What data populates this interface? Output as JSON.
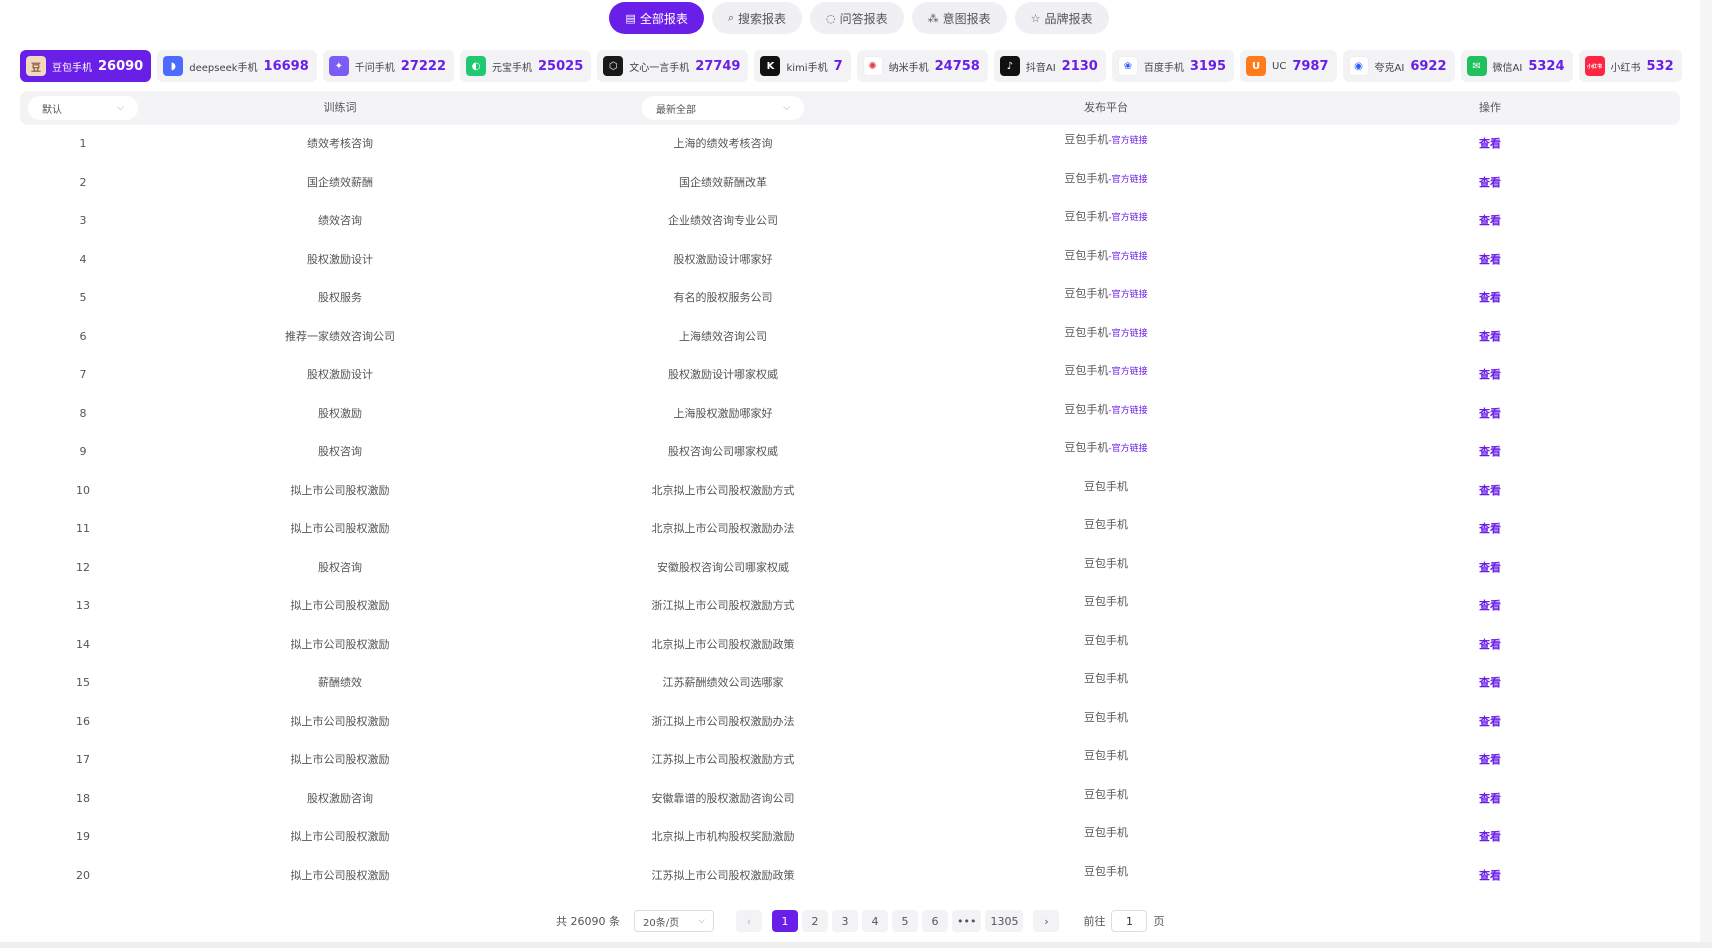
{
  "tabs": [
    {
      "label": "全部报表",
      "icon": "report-icon",
      "active": true
    },
    {
      "label": "搜索报表",
      "icon": "search-icon",
      "active": false
    },
    {
      "label": "问答报表",
      "icon": "chat-icon",
      "active": false
    },
    {
      "label": "意图报表",
      "icon": "intent-icon",
      "active": false
    },
    {
      "label": "品牌报表",
      "icon": "star-icon",
      "active": false
    }
  ],
  "platforms": [
    {
      "name": "豆包手机",
      "count": "26090",
      "icon": "doubao-icon",
      "color": "#f1d9c0",
      "glyph": "豆",
      "active": true
    },
    {
      "name": "deepseek手机",
      "count": "16698",
      "icon": "deepseek-icon",
      "color": "#4d6bfe",
      "glyph": "◗",
      "active": false
    },
    {
      "name": "千问手机",
      "count": "27222",
      "icon": "qianwen-icon",
      "color": "#7b5cf5",
      "glyph": "✦",
      "active": false
    },
    {
      "name": "元宝手机",
      "count": "25025",
      "icon": "yuanbao-icon",
      "color": "#1fc873",
      "glyph": "◐",
      "active": false
    },
    {
      "name": "文心一言手机",
      "count": "27749",
      "icon": "wenxin-icon",
      "color": "#1a1a1a",
      "glyph": "⬡",
      "active": false
    },
    {
      "name": "kimi手机",
      "count": "7",
      "icon": "kimi-icon",
      "color": "#111111",
      "glyph": "K",
      "active": false
    },
    {
      "name": "纳米手机",
      "count": "24758",
      "icon": "nami-icon",
      "color": "#ffffff",
      "glyph": "✺",
      "active": false
    },
    {
      "name": "抖音AI",
      "count": "2130",
      "icon": "douyin-icon",
      "color": "#111111",
      "glyph": "♪",
      "active": false
    },
    {
      "name": "百度手机",
      "count": "3195",
      "icon": "baidu-icon",
      "color": "#ffffff",
      "glyph": "❀",
      "active": false
    },
    {
      "name": "UC",
      "count": "7987",
      "icon": "uc-icon",
      "color": "#ff7a1a",
      "glyph": "U",
      "active": false
    },
    {
      "name": "夸克AI",
      "count": "6922",
      "icon": "quark-icon",
      "color": "#ffffff",
      "glyph": "◉",
      "active": false
    },
    {
      "name": "微信AI",
      "count": "5324",
      "icon": "wechat-icon",
      "color": "#20c05c",
      "glyph": "✉",
      "active": false
    },
    {
      "name": "小红书",
      "count": "532",
      "icon": "xiaohongshu-icon",
      "color": "#ff2442",
      "glyph": "小红书",
      "active": false
    }
  ],
  "table": {
    "sort_select": "默认",
    "col_keyword": "训练词",
    "filter_select": "最新全部",
    "col_platform": "发布平台",
    "col_action": "操作",
    "official_link": "-官方链接",
    "view_label": "查看",
    "rows": [
      {
        "index": "1",
        "keyword": "绩效考核咨询",
        "question": "上海的绩效考核咨询",
        "platform": "豆包手机",
        "official": true
      },
      {
        "index": "2",
        "keyword": "国企绩效薪酬",
        "question": "国企绩效薪酬改革",
        "platform": "豆包手机",
        "official": true
      },
      {
        "index": "3",
        "keyword": "绩效咨询",
        "question": "企业绩效咨询专业公司",
        "platform": "豆包手机",
        "official": true
      },
      {
        "index": "4",
        "keyword": "股权激励设计",
        "question": "股权激励设计哪家好",
        "platform": "豆包手机",
        "official": true
      },
      {
        "index": "5",
        "keyword": "股权服务",
        "question": "有名的股权服务公司",
        "platform": "豆包手机",
        "official": true
      },
      {
        "index": "6",
        "keyword": "推荐一家绩效咨询公司",
        "question": "上海绩效咨询公司",
        "platform": "豆包手机",
        "official": true
      },
      {
        "index": "7",
        "keyword": "股权激励设计",
        "question": "股权激励设计哪家权威",
        "platform": "豆包手机",
        "official": true
      },
      {
        "index": "8",
        "keyword": "股权激励",
        "question": "上海股权激励哪家好",
        "platform": "豆包手机",
        "official": true
      },
      {
        "index": "9",
        "keyword": "股权咨询",
        "question": "股权咨询公司哪家权威",
        "platform": "豆包手机",
        "official": true
      },
      {
        "index": "10",
        "keyword": "拟上市公司股权激励",
        "question": "北京拟上市公司股权激励方式",
        "platform": "豆包手机",
        "official": false
      },
      {
        "index": "11",
        "keyword": "拟上市公司股权激励",
        "question": "北京拟上市公司股权激励办法",
        "platform": "豆包手机",
        "official": false
      },
      {
        "index": "12",
        "keyword": "股权咨询",
        "question": "安徽股权咨询公司哪家权威",
        "platform": "豆包手机",
        "official": false
      },
      {
        "index": "13",
        "keyword": "拟上市公司股权激励",
        "question": "浙江拟上市公司股权激励方式",
        "platform": "豆包手机",
        "official": false
      },
      {
        "index": "14",
        "keyword": "拟上市公司股权激励",
        "question": "北京拟上市公司股权激励政策",
        "platform": "豆包手机",
        "official": false
      },
      {
        "index": "15",
        "keyword": "薪酬绩效",
        "question": "江苏薪酬绩效公司选哪家",
        "platform": "豆包手机",
        "official": false
      },
      {
        "index": "16",
        "keyword": "拟上市公司股权激励",
        "question": "浙江拟上市公司股权激励办法",
        "platform": "豆包手机",
        "official": false
      },
      {
        "index": "17",
        "keyword": "拟上市公司股权激励",
        "question": "江苏拟上市公司股权激励方式",
        "platform": "豆包手机",
        "official": false
      },
      {
        "index": "18",
        "keyword": "股权激励咨询",
        "question": "安徽靠谱的股权激励咨询公司",
        "platform": "豆包手机",
        "official": false
      },
      {
        "index": "19",
        "keyword": "拟上市公司股权激励",
        "question": "北京拟上市机构股权奖励激励",
        "platform": "豆包手机",
        "official": false
      },
      {
        "index": "20",
        "keyword": "拟上市公司股权激励",
        "question": "江苏拟上市公司股权激励政策",
        "platform": "豆包手机",
        "official": false
      }
    ]
  },
  "pagination": {
    "total": "共 26090 条",
    "page_size": "20条/页",
    "prev": "‹",
    "pages": [
      "1",
      "2",
      "3",
      "4",
      "5",
      "6",
      "•••",
      "1305"
    ],
    "current": "1",
    "next": "›",
    "goto_label": "前往",
    "goto_value": "1",
    "goto_suffix": "页"
  },
  "colors": {
    "accent": "#6a1fe8",
    "header_bg": "#f4f4f7"
  }
}
